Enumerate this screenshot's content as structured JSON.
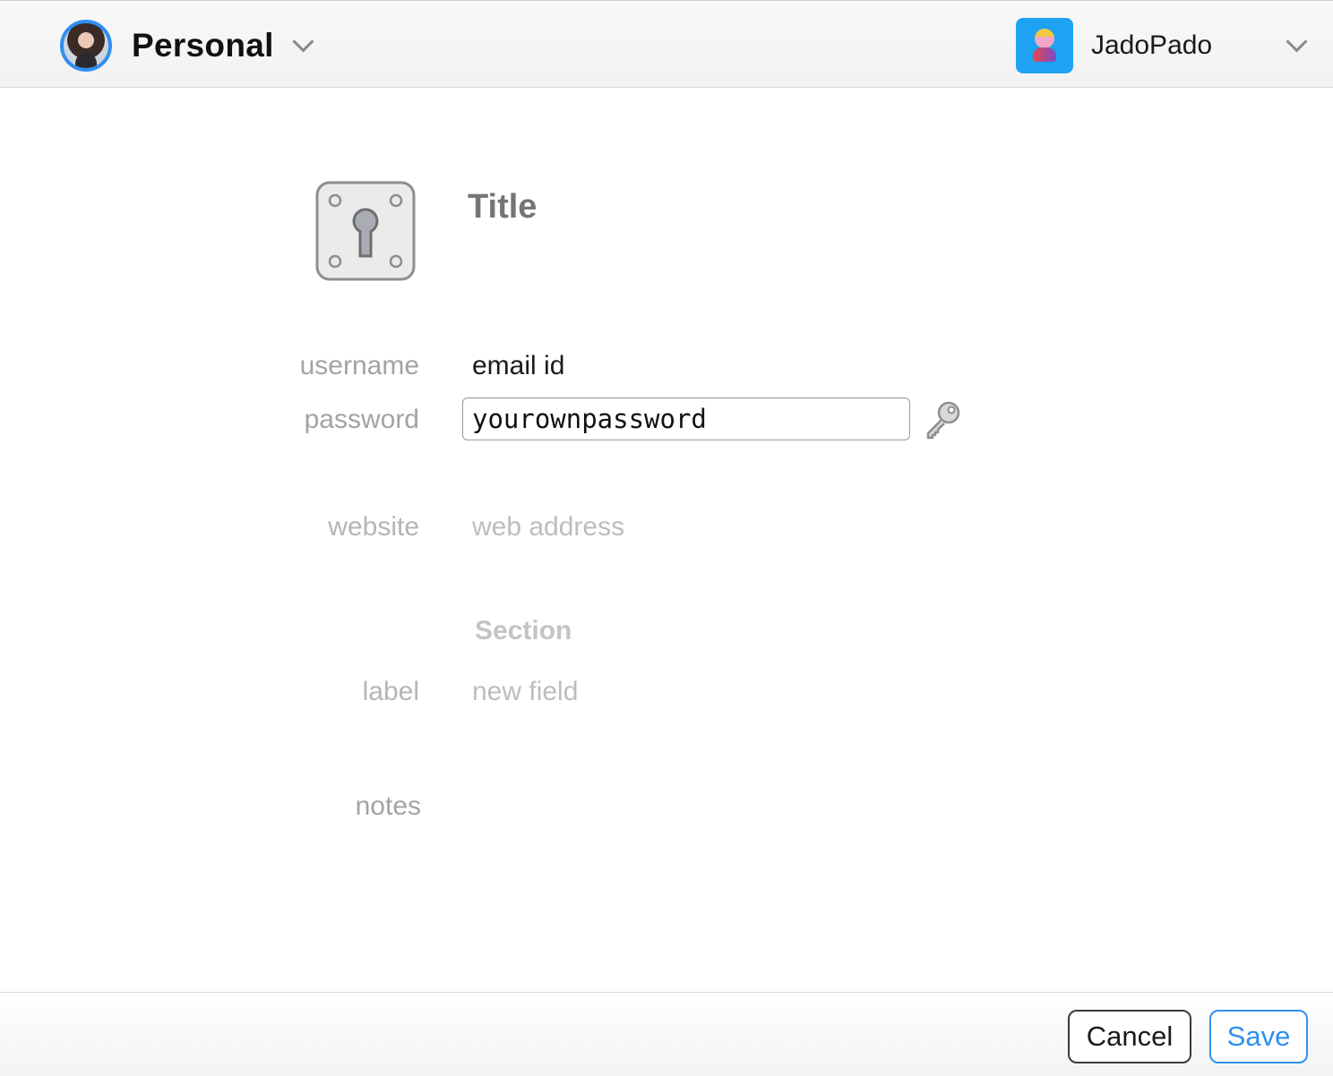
{
  "header": {
    "vault_name": "Personal",
    "account_name": "JadoPado"
  },
  "item": {
    "title_placeholder": "Title"
  },
  "fields": {
    "username": {
      "label": "username",
      "value": "email id"
    },
    "password": {
      "label": "password",
      "value": "yourownpassword"
    },
    "website": {
      "label": "website",
      "placeholder": "web address"
    },
    "section_title": "Section",
    "custom": {
      "label": "label",
      "placeholder": "new field"
    },
    "notes": {
      "label": "notes"
    }
  },
  "footer": {
    "cancel_label": "Cancel",
    "save_label": "Save"
  },
  "colors": {
    "accent": "#2f8ff0",
    "account_icon_bg": "#1ea3f2"
  }
}
